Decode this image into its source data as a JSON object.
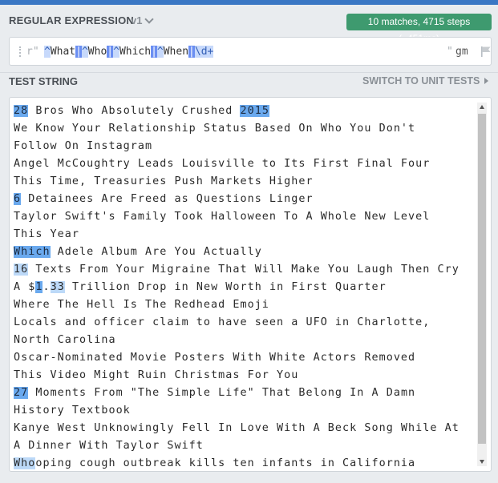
{
  "header": {
    "title": "REGULAR EXPRESSION",
    "version": "v1",
    "match_badge": "10 matches, 4715 steps (~451ms)"
  },
  "regex": {
    "open_delim": "r\"",
    "close_delim": "\"",
    "flags": "gm",
    "tokens": [
      {
        "text": "^",
        "kind": "anchor"
      },
      {
        "text": "What",
        "kind": "literal"
      },
      {
        "text": "|",
        "kind": "alt"
      },
      {
        "text": "^",
        "kind": "anchor"
      },
      {
        "text": "Who",
        "kind": "literal"
      },
      {
        "text": "|",
        "kind": "alt"
      },
      {
        "text": "^",
        "kind": "anchor"
      },
      {
        "text": "Which",
        "kind": "literal"
      },
      {
        "text": "|",
        "kind": "alt"
      },
      {
        "text": "^",
        "kind": "anchor"
      },
      {
        "text": "When",
        "kind": "literal"
      },
      {
        "text": "|",
        "kind": "alt"
      },
      {
        "text": "\\d+",
        "kind": "esc"
      }
    ]
  },
  "test_string": {
    "title": "TEST STRING",
    "switch_label": "SWITCH TO UNIT TESTS",
    "lines": [
      [
        {
          "t": "28",
          "m": 1
        },
        {
          "t": " Bros Who Absolutely Crushed "
        },
        {
          "t": "2015",
          "m": 1
        }
      ],
      [
        {
          "t": "We Know Your Relationship Status Based On Who You Don't"
        }
      ],
      [
        {
          "t": "Follow On Instagram"
        }
      ],
      [
        {
          "t": "Angel McCoughtry Leads Louisville to Its First Final Four"
        }
      ],
      [
        {
          "t": "This Time, Treasuries Push Markets Higher"
        }
      ],
      [
        {
          "t": "6",
          "m": 1
        },
        {
          "t": " Detainees Are Freed as Questions Linger"
        }
      ],
      [
        {
          "t": "Taylor Swift's Family Took Halloween To A Whole New Level"
        }
      ],
      [
        {
          "t": "This Year"
        }
      ],
      [
        {
          "t": "Which",
          "m": 1
        },
        {
          "t": " Adele Album Are You Actually"
        }
      ],
      [
        {
          "t": "16",
          "m": 2
        },
        {
          "t": " Texts From Your Migraine That Will Make You Laugh Then Cry"
        }
      ],
      [
        {
          "t": "A $"
        },
        {
          "t": "1",
          "m": 1
        },
        {
          "t": "."
        },
        {
          "t": "33",
          "m": 2
        },
        {
          "t": " Trillion Drop in New Worth in First Quarter"
        }
      ],
      [
        {
          "t": "Where The Hell Is The Redhead Emoji"
        }
      ],
      [
        {
          "t": "Locals and officer claim to have seen a UFO in Charlotte,"
        }
      ],
      [
        {
          "t": "North Carolina"
        }
      ],
      [
        {
          "t": "Oscar-Nominated Movie Posters With White Actors Removed"
        }
      ],
      [
        {
          "t": "This Video Might Ruin Christmas For You"
        }
      ],
      [
        {
          "t": "27",
          "m": 1
        },
        {
          "t": " Moments From \"The Simple Life\" That Belong In A Damn"
        }
      ],
      [
        {
          "t": "History Textbook"
        }
      ],
      [
        {
          "t": "Kanye West Unknowingly Fell In Love With A Beck Song While At"
        }
      ],
      [
        {
          "t": "A Dinner With Taylor Swift"
        }
      ],
      [
        {
          "t": "Who",
          "m": 2
        },
        {
          "t": "oping cough outbreak kills ten infants in California"
        }
      ]
    ]
  }
}
